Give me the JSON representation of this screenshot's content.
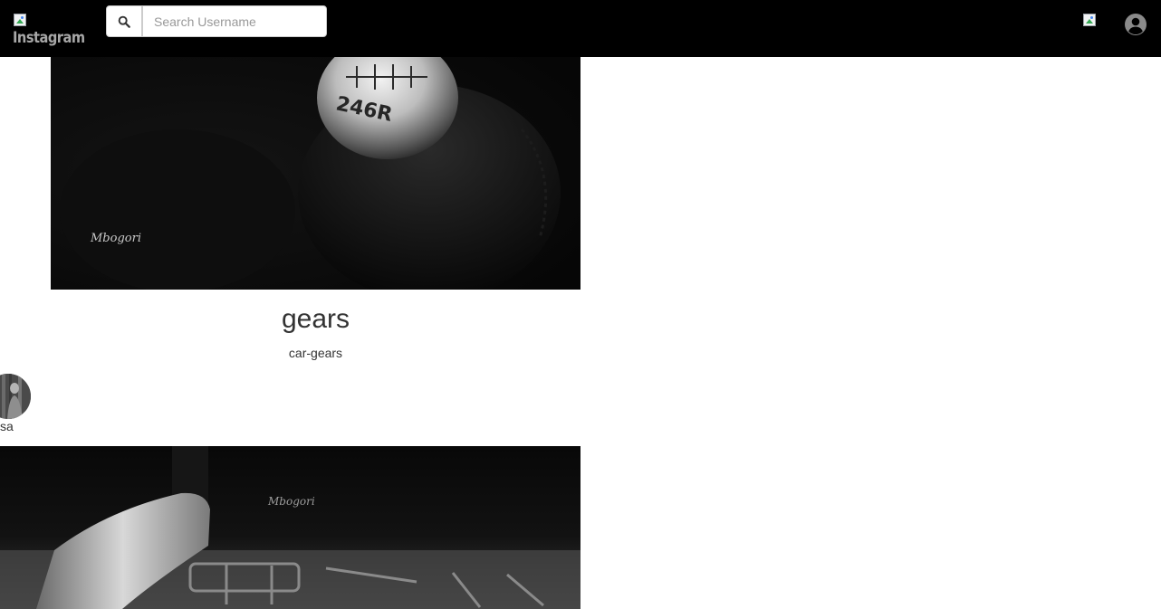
{
  "navbar": {
    "logo_alt": "Instagram",
    "search_icon": "search-icon",
    "search_placeholder": "Search Username",
    "nav_image_icon": "broken-image-icon",
    "profile_icon": "user-circle-icon"
  },
  "posts": [
    {
      "image_signature": "Mbogori",
      "image_knob_text": "246R",
      "title": "gears",
      "caption": "car-gears"
    },
    {
      "username": "sa",
      "image_signature": "Mbogori"
    }
  ],
  "colors": {
    "navbar_bg": "#000000",
    "page_bg": "#ffffff",
    "text": "#333333",
    "icon_gray": "#8a8a8a"
  }
}
